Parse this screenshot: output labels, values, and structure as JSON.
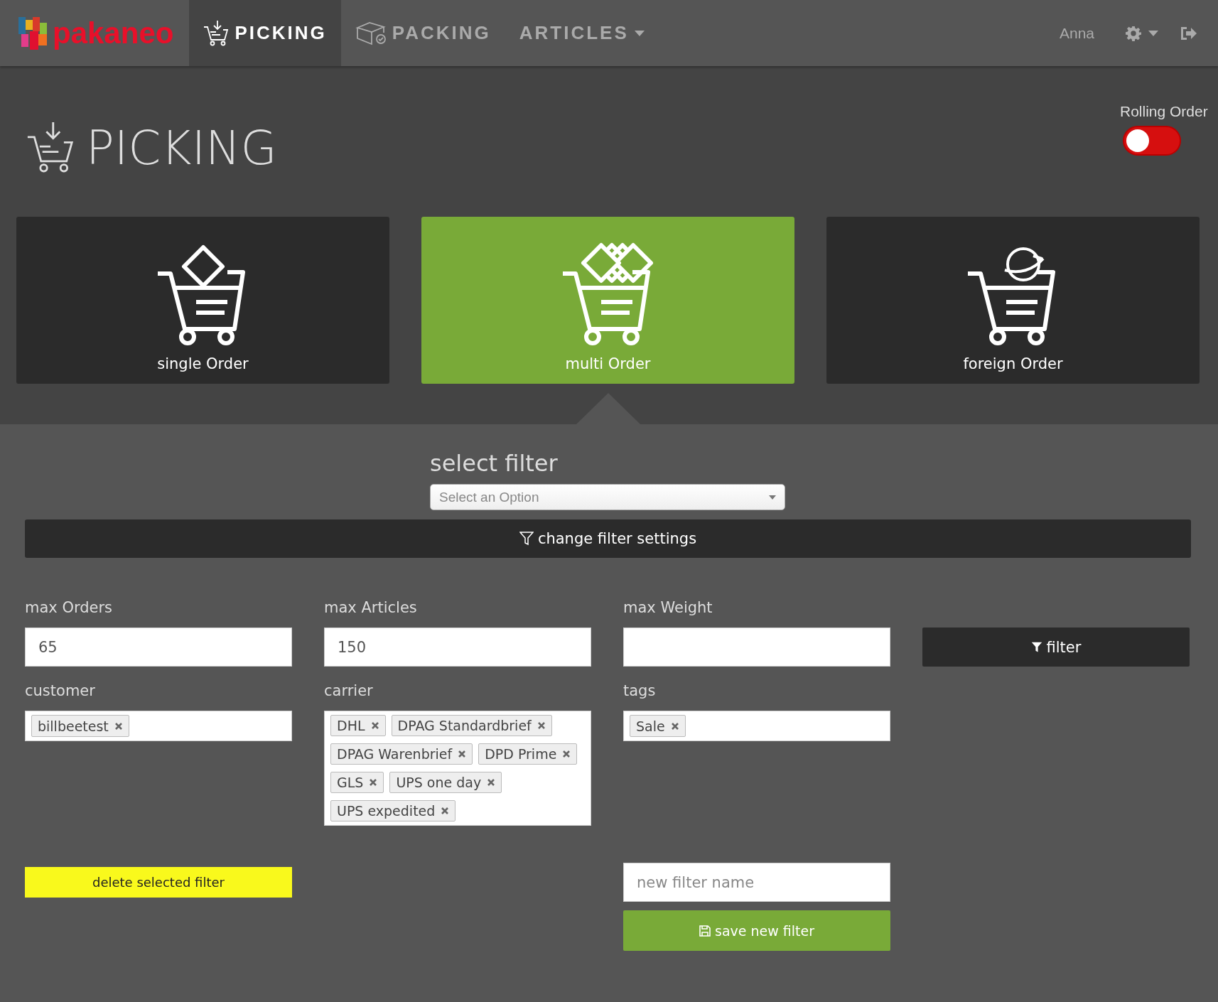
{
  "navbar": {
    "logo": "pakaneo",
    "items": [
      {
        "label": "PICKING",
        "kind": "picking",
        "selected": true
      },
      {
        "label": "PACKING",
        "kind": "packing",
        "selected": false
      },
      {
        "label": "ARTICLES",
        "kind": "dropdown",
        "selected": false
      }
    ],
    "user": "Anna"
  },
  "header": {
    "title": "PICKING",
    "rolling_order": {
      "label": "Rolling Order",
      "on": false
    }
  },
  "order_types": [
    {
      "label": "single Order",
      "kind": "single",
      "selected": false
    },
    {
      "label": "multi Order",
      "kind": "multi",
      "selected": true
    },
    {
      "label": "foreign Order",
      "kind": "foreign",
      "selected": false
    }
  ],
  "select_filter": {
    "title": "select filter",
    "placeholder": "Select an Option"
  },
  "change_filter_button": "change filter settings",
  "fields": [
    {
      "label": "max Orders",
      "value": "65"
    },
    {
      "label": "max Articles",
      "value": "150"
    },
    {
      "label": "max Weight"
    }
  ],
  "filter_button": "filter",
  "tag_fields": [
    {
      "label": "customer",
      "tags": [
        "billbeetest"
      ]
    },
    {
      "label": "carrier",
      "tags": [
        "DHL",
        "DPAG Standardbrief",
        "DPAG Warenbrief",
        "DPD Prime",
        "GLS",
        "UPS one day",
        "UPS expedited"
      ]
    },
    {
      "label": "tags",
      "tags": [
        "Sale"
      ]
    }
  ],
  "delete_button": "delete selected filter",
  "new_filter": {
    "placeholder": "new filter name",
    "save_button": "save new filter"
  }
}
